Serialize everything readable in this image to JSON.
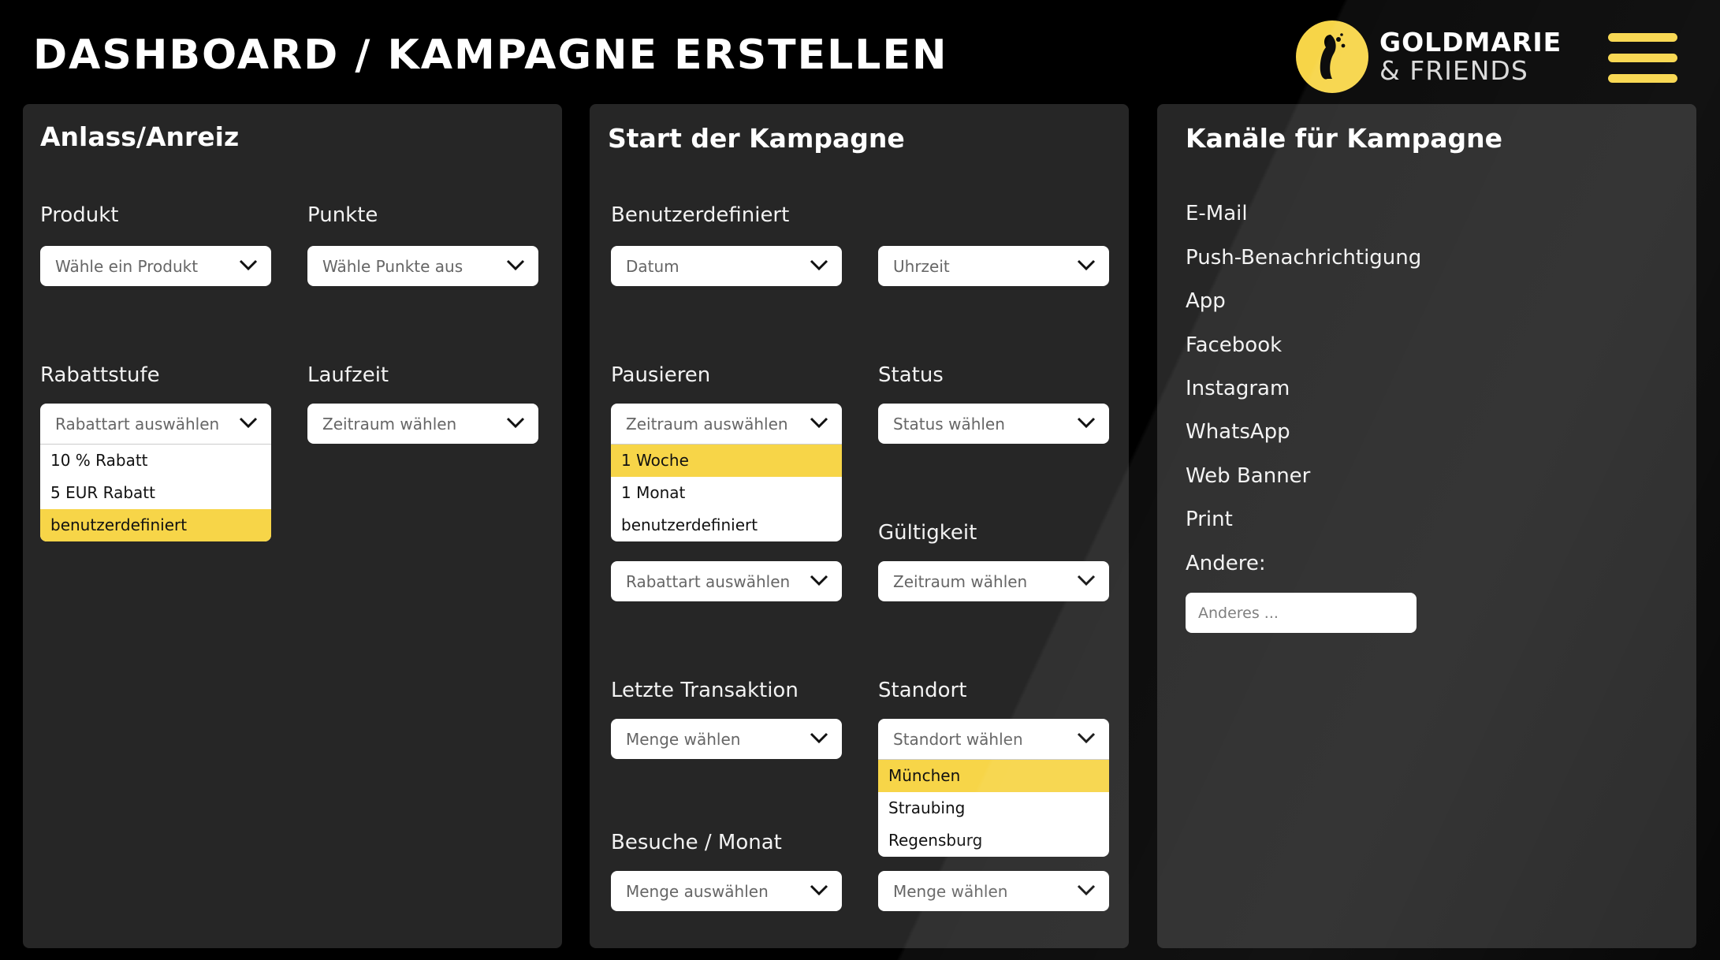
{
  "header": {
    "title": "DASHBOARD / KAMPAGNE ERSTELLEN",
    "logo_line1": "GOLDMARIE",
    "logo_line2": "& FRIENDS",
    "menu_icon": "hamburger-icon"
  },
  "colors": {
    "accent": "#f7d548",
    "panel": "#262626",
    "background": "#000000"
  },
  "anlass": {
    "title": "Anlass/Anreiz",
    "produkt": {
      "label": "Produkt",
      "placeholder": "Wähle ein Produkt"
    },
    "punkte": {
      "label": "Punkte",
      "placeholder": "Wähle Punkte aus"
    },
    "rabattstufe": {
      "label": "Rabattstufe",
      "placeholder": "Rabattart auswählen",
      "options": [
        "10 % Rabatt",
        "5 EUR Rabatt",
        "benutzerdefiniert"
      ],
      "selected": "benutzerdefiniert"
    },
    "laufzeit": {
      "label": "Laufzeit",
      "placeholder": "Zeitraum wählen"
    }
  },
  "start": {
    "title": "Start der Kampagne",
    "benutzerdefiniert": {
      "label": "Benutzerdefiniert",
      "datum": "Datum",
      "uhrzeit": "Uhrzeit"
    },
    "pausieren": {
      "label": "Pausieren",
      "placeholder": "Zeitraum auswählen",
      "options": [
        "1 Woche",
        "1 Monat",
        "benutzerdefiniert"
      ],
      "selected": "1 Woche"
    },
    "rabattart": {
      "placeholder": "Rabattart auswählen"
    },
    "status": {
      "label": "Status",
      "placeholder": "Status wählen"
    },
    "gueltigkeit": {
      "label": "Gültigkeit",
      "placeholder": "Zeitraum wählen"
    },
    "letzte_transaktion": {
      "label": "Letzte Transaktion",
      "placeholder": "Menge wählen"
    },
    "standort": {
      "label": "Standort",
      "placeholder": "Standort wählen",
      "options": [
        "München",
        "Straubing",
        "Regensburg"
      ],
      "selected": "München"
    },
    "besuche": {
      "label": "Besuche / Monat",
      "placeholder": "Menge auswählen"
    },
    "menge": {
      "placeholder": "Menge wählen"
    }
  },
  "kanaele": {
    "title": "Kanäle für Kampagne",
    "items": [
      "E-Mail",
      "Push-Benachrichtigung",
      "App",
      "Facebook",
      "Instagram",
      "WhatsApp",
      "Web Banner",
      "Print"
    ],
    "andere_label": "Andere:",
    "andere_placeholder": "Anderes ..."
  }
}
